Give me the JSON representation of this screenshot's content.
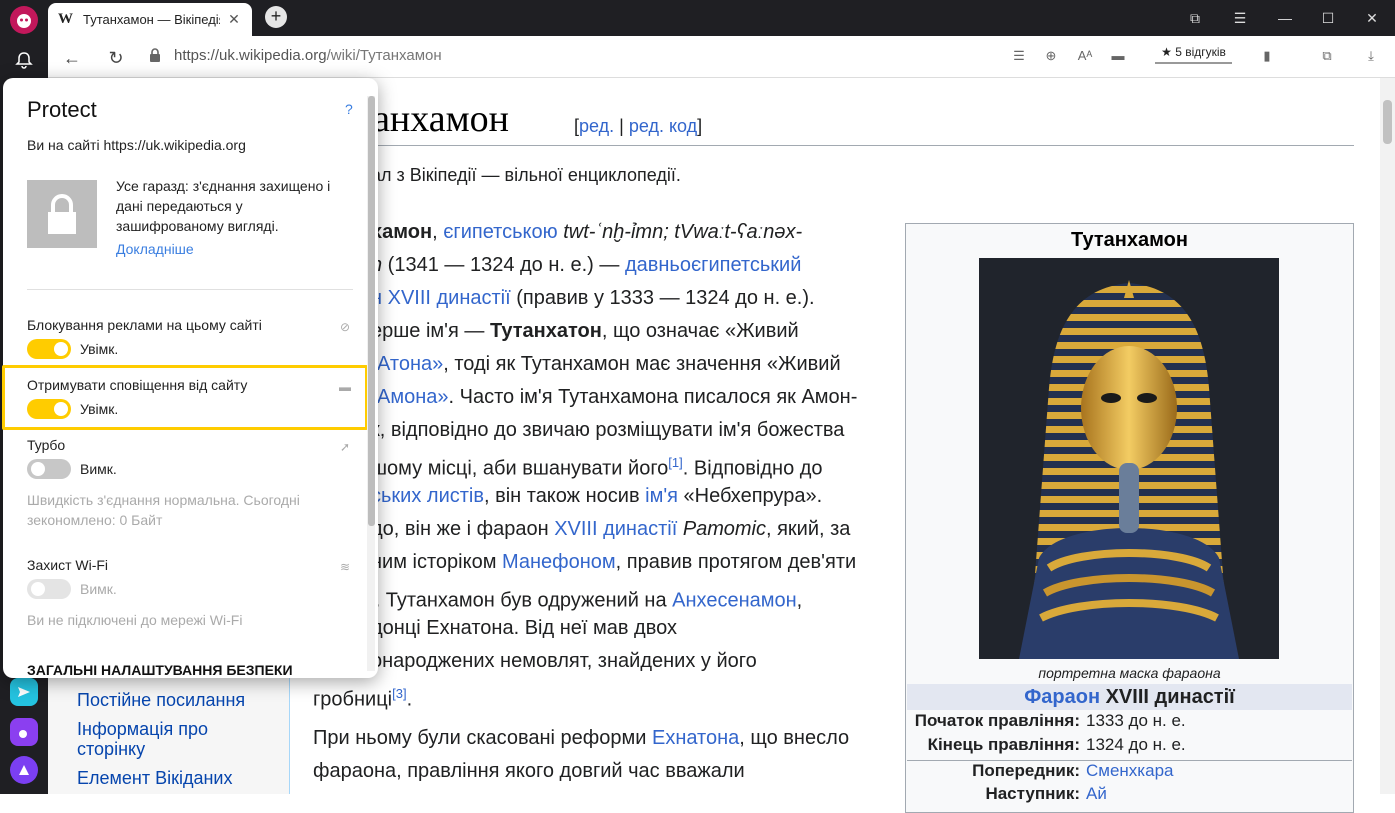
{
  "browser": {
    "tab_title": "Тутанхамон — Вікіпедія",
    "tab_logo": "W",
    "url_host": "https://uk.wikipedia.org",
    "url_path": "/wiki/Тутанхамон",
    "reviews": "5 відгуків"
  },
  "article": {
    "title_fragment": "танхамон",
    "edit_open": "[",
    "edit_link": "ред.",
    "edit_sep": " | ",
    "edit_code_link": "ред. код",
    "edit_close": "]",
    "subtitle": "ал з Вікіпедії — вільної енциклопедії.",
    "lines": [
      "хамон, єгипетською twt-ʿnḫ-ỉmn; tVwaːt-ʕaːnəx-",
      "n (1341 — 1324  до н. е.) — давньоєгипетський",
      "н XVIII династії (правив у 1333 — 1324  до н. е.).",
      "ерше ім'я — Тутанхатон, що означає «Живий",
      "Атона», тоді як Тутанхамон має значення «Живий",
      "Амона». Часто ім'я Тутанхамона писалося як Амон-",
      "к, відповідно до звичаю розміщувати ім'я божества",
      "шому місці, аби вшанувати його",
      "ських листів, він також носив ім'я «Небхепрура».",
      "до, він же і фараон XVIII династії Ратотіс, який, за",
      "ним історіком Манефоном, правив протягом дев'яти",
      ". Тутанхамон був одружений на Анхесенамон,",
      "донці Ехнатона. Від неї мав двох",
      "онароджених немовлят, знайдених у його",
      "гробниці",
      "При ньому були скасовані реформи Ехнатона, що внесло",
      "фараона, правління якого довгий час вважали"
    ],
    "ref1": "[1]",
    "ref1_after": ". Відповідно до",
    "ref3": "[3]",
    "ref3_after": ".",
    "ref_partial": "]"
  },
  "infobox": {
    "title": "Тутанхамон",
    "caption": "портретна маска фараона",
    "dynasty_link": "Фараон",
    "dynasty_rest": " XVIII династії",
    "start_label": "Початок правління:",
    "start_value": "1333 до н. е.",
    "end_label": "Кінець правління:",
    "end_value": "1324 до н. е.",
    "pred_label": "Попередник:",
    "pred_value": "Сменхкара",
    "succ_label": "Наступник:",
    "succ_value": "Ай"
  },
  "wiki_sidebar": {
    "links": [
      "Постійне посилання",
      "Інформація про",
      "сторінку",
      "Елемент Вікіданих"
    ]
  },
  "protect": {
    "title": "Protect",
    "help": "?",
    "site_line": "Ви на сайті https://uk.wikipedia.org",
    "status_lines": [
      "Усе гаразд: з'єднання захищено і",
      "дані передаються у",
      "зашифрованому вигляді."
    ],
    "more_link": "Докладніше",
    "ads_label": "Блокування реклами на цьому сайті",
    "ads_state": "Увімк.",
    "notif_label": "Отримувати сповіщення від сайту",
    "notif_state": "Увімк.",
    "turbo_label": "Турбо",
    "turbo_state": "Вимк.",
    "turbo_info_1": "Швидкість з'єднання нормальна. Сьогодні",
    "turbo_info_2": "зекономлено: 0 Байт",
    "wifi_label": "Захист Wi-Fi",
    "wifi_state": "Вимк.",
    "wifi_info": "Ви не підключені до мережі Wi-Fi",
    "general_header": "ЗАГАЛЬНІ НАЛАШТУВАННЯ БЕЗПЕКИ"
  },
  "colors": {
    "accent": "#ffcc00",
    "link": "#3366cc",
    "toggle_off": "#c7c7c7"
  }
}
